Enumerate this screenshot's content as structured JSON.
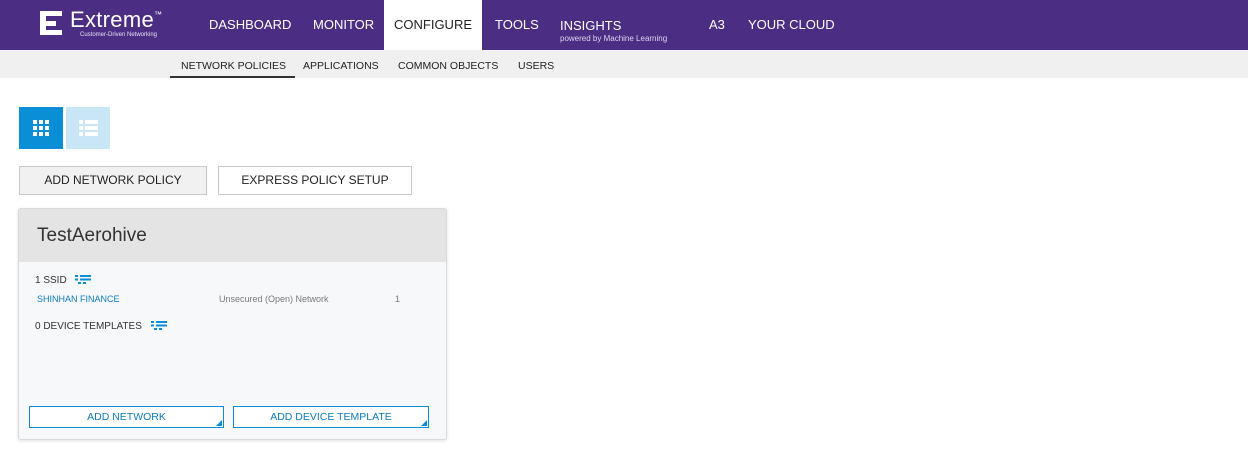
{
  "brand": {
    "name": "Extreme",
    "trademark": "™",
    "tagline": "Customer-Driven Networking"
  },
  "nav": {
    "items": [
      {
        "label": "DASHBOARD"
      },
      {
        "label": "MONITOR"
      },
      {
        "label": "CONFIGURE",
        "active": true
      },
      {
        "label": "TOOLS"
      },
      {
        "label": "INSIGHTS",
        "sublabel": "powered by Machine Learning"
      },
      {
        "label": "A3"
      },
      {
        "label": "YOUR CLOUD"
      }
    ]
  },
  "subnav": {
    "items": [
      {
        "label": "NETWORK POLICIES",
        "active": true
      },
      {
        "label": "APPLICATIONS"
      },
      {
        "label": "COMMON OBJECTS"
      },
      {
        "label": "USERS"
      }
    ]
  },
  "view_toggle": {
    "grid": {
      "icon": "grid-view-icon",
      "active": true
    },
    "list": {
      "icon": "list-view-icon",
      "active": false
    }
  },
  "actions": {
    "add_policy_label": "ADD NETWORK POLICY",
    "express_label": "EXPRESS POLICY SETUP"
  },
  "policy_card": {
    "title": "TestAerohive",
    "ssid_header": "1  SSID",
    "ssid": {
      "name": "SHINHAN FINANCE",
      "security": "Unsecured (Open) Network",
      "count": "1"
    },
    "templates_header": "0  DEVICE TEMPLATES",
    "add_network_label": "ADD NETWORK",
    "add_template_label": "ADD DEVICE TEMPLATE"
  },
  "colors": {
    "topbar": "#4b2e83",
    "accent_blue": "#0a8fd6",
    "link_blue": "#0a7cc2"
  }
}
